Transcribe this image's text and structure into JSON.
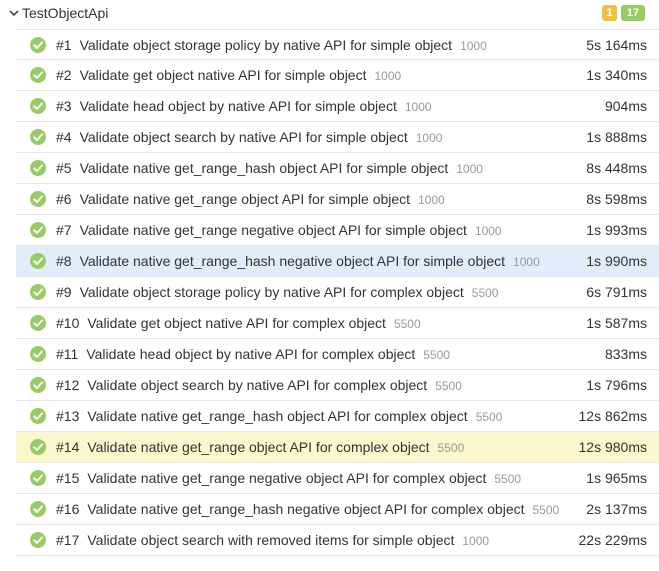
{
  "group": {
    "title": "TestObjectApi",
    "badge_broken": "1",
    "badge_passed": "17"
  },
  "colors": {
    "passed": "#97cc64",
    "broken": "#f0c040",
    "selected_row": "#e3ecfa",
    "highlight_row": "#fcf6cc"
  },
  "tests": [
    {
      "order": "#1",
      "name": "Validate object storage policy by native API for simple object",
      "param": "1000",
      "duration": "5s 164ms",
      "status": "passed"
    },
    {
      "order": "#2",
      "name": "Validate get object native API for simple object",
      "param": "1000",
      "duration": "1s 340ms",
      "status": "passed"
    },
    {
      "order": "#3",
      "name": "Validate head object by native API for simple object",
      "param": "1000",
      "duration": "904ms",
      "status": "passed"
    },
    {
      "order": "#4",
      "name": "Validate object search by native API for simple object",
      "param": "1000",
      "duration": "1s 888ms",
      "status": "passed"
    },
    {
      "order": "#5",
      "name": "Validate native get_range_hash object API for simple object",
      "param": "1000",
      "duration": "8s 448ms",
      "status": "passed"
    },
    {
      "order": "#6",
      "name": "Validate native get_range object API for simple object",
      "param": "1000",
      "duration": "8s 598ms",
      "status": "passed"
    },
    {
      "order": "#7",
      "name": "Validate native get_range negative object API for simple object",
      "param": "1000",
      "duration": "1s 993ms",
      "status": "passed"
    },
    {
      "order": "#8",
      "name": "Validate native get_range_hash negative object API for simple object",
      "param": "1000",
      "duration": "1s 990ms",
      "status": "passed"
    },
    {
      "order": "#9",
      "name": "Validate object storage policy by native API for complex object",
      "param": "5500",
      "duration": "6s 791ms",
      "status": "passed"
    },
    {
      "order": "#10",
      "name": "Validate get object native API for complex object",
      "param": "5500",
      "duration": "1s 587ms",
      "status": "passed"
    },
    {
      "order": "#11",
      "name": "Validate head object by native API for complex object",
      "param": "5500",
      "duration": "833ms",
      "status": "passed"
    },
    {
      "order": "#12",
      "name": "Validate object search by native API for complex object",
      "param": "5500",
      "duration": "1s 796ms",
      "status": "passed"
    },
    {
      "order": "#13",
      "name": "Validate native get_range_hash object API for complex object",
      "param": "5500",
      "duration": "12s 862ms",
      "status": "passed"
    },
    {
      "order": "#14",
      "name": "Validate native get_range object API for complex object",
      "param": "5500",
      "duration": "12s 980ms",
      "status": "passed"
    },
    {
      "order": "#15",
      "name": "Validate native get_range negative object API for complex object",
      "param": "5500",
      "duration": "1s 965ms",
      "status": "passed"
    },
    {
      "order": "#16",
      "name": "Validate native get_range_hash negative object API for complex object",
      "param": "5500",
      "duration": "2s 137ms",
      "status": "passed"
    },
    {
      "order": "#17",
      "name": "Validate object search with removed items for simple object",
      "param": "1000",
      "duration": "22s 229ms",
      "status": "passed"
    }
  ],
  "selected_index": 7,
  "highlight_index": 13
}
